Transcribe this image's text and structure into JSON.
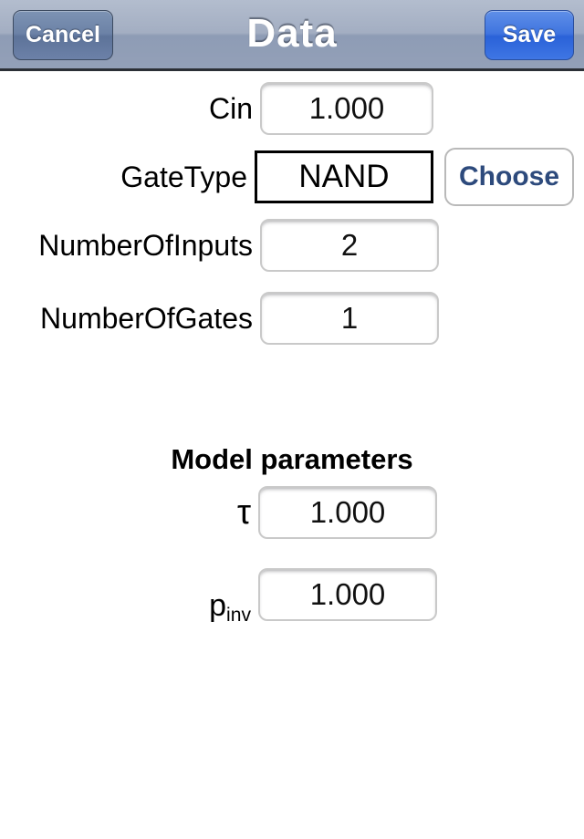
{
  "navbar": {
    "cancel_label": "Cancel",
    "title": "Data",
    "save_label": "Save",
    "tint_default": "#3f76e4",
    "tint_plain": "#6c81a8"
  },
  "form": {
    "fields": [
      {
        "label": "Cin",
        "value": "1.000"
      },
      {
        "label": "NumberOfInputs",
        "value": "2"
      },
      {
        "label": "NumberOfGates",
        "value": "1"
      }
    ],
    "gate_type": {
      "label": "GateType",
      "value": "NAND",
      "choose_label": "Choose",
      "choose_color": "#2d4a7c"
    }
  },
  "model": {
    "header": "Model parameters",
    "tau": {
      "label": "τ",
      "value": "1.000"
    },
    "p_inv": {
      "label_base": "p",
      "label_sub": "inv",
      "value": "1.000"
    }
  }
}
